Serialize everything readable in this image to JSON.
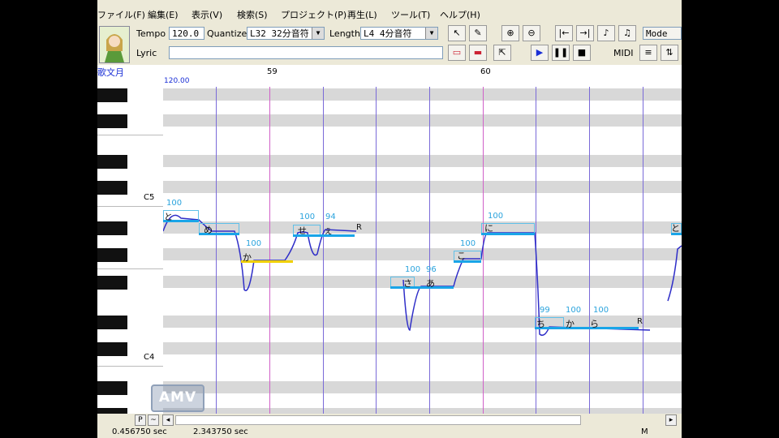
{
  "menu": [
    "ファイル(F)",
    "編集(E)",
    "表示(V)",
    "検索(S)",
    "プロジェクト(P)",
    "再生(L)",
    "ツール(T)",
    "ヘルプ(H)"
  ],
  "toolbar": {
    "tempo_label": "Tempo",
    "tempo_value": "120.0",
    "quantize_label": "Quantize",
    "quantize_value": "L32 32分音符",
    "length_label": "Length",
    "length_value": "L4 4分音符",
    "lyric_label": "Lyric",
    "lyric_value": "",
    "midi_label": "MIDI",
    "mode_label": "Mode"
  },
  "track": {
    "name": "歌文月",
    "tempo_marker": "120.00"
  },
  "ruler": {
    "measures": [
      "59",
      "60"
    ]
  },
  "keys": {
    "c5_label": "C5",
    "c4_label": "C4"
  },
  "notes": [
    {
      "lyric": "と",
      "vel": "100"
    },
    {
      "lyric": "め",
      "vel": ""
    },
    {
      "lyric": "か",
      "vel": "100"
    },
    {
      "lyric": "せ",
      "vel": "100"
    },
    {
      "lyric": "ぇ",
      "vel": "94"
    },
    {
      "lyric": "さ",
      "vel": "100"
    },
    {
      "lyric": "あ",
      "vel": "96"
    },
    {
      "lyric": "こ",
      "vel": "100"
    },
    {
      "lyric": "に",
      "vel": "100"
    },
    {
      "lyric": "ち",
      "vel": "99"
    },
    {
      "lyric": "か",
      "vel": "100"
    },
    {
      "lyric": "ら",
      "vel": "100"
    },
    {
      "lyric": "と",
      "vel": ""
    }
  ],
  "rest_marks": [
    "R",
    "R"
  ],
  "watermark": "AMV",
  "status": {
    "time_left": "0.456750 sec",
    "time_right": "2.343750 sec",
    "mode_char": "M"
  },
  "scroll": {
    "p_label": "P",
    "tilde_label": "~"
  }
}
